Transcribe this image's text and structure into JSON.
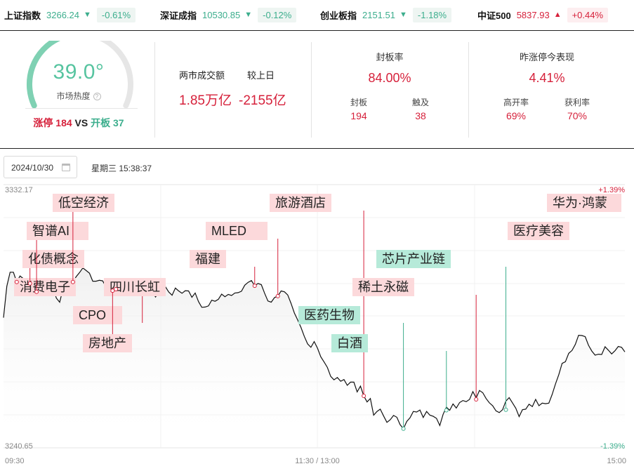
{
  "indices": [
    {
      "name": "上证指数",
      "value": "3266.24",
      "arrow": "▼",
      "change": "-0.61%",
      "dir": "down"
    },
    {
      "name": "深证成指",
      "value": "10530.85",
      "arrow": "▼",
      "change": "-0.12%",
      "dir": "down"
    },
    {
      "name": "创业板指",
      "value": "2151.51",
      "arrow": "▼",
      "change": "-1.18%",
      "dir": "down"
    },
    {
      "name": "中证500",
      "value": "5837.93",
      "arrow": "▲",
      "change": "+0.44%",
      "dir": "up"
    }
  ],
  "heat": {
    "value": "39.0°",
    "label": "市场热度",
    "help_icon": "question-icon",
    "level": 0.39,
    "zt_label": "涨停",
    "zt_count": "184",
    "vs": "VS",
    "kb_label": "开板",
    "kb_count": "37"
  },
  "turnover": {
    "label1": "两市成交额",
    "label2": "较上日",
    "value1": "1.85万亿",
    "value2": "-2155亿"
  },
  "seal": {
    "title": "封板率",
    "rate": "84.00%",
    "sub1_label": "封板",
    "sub1_value": "194",
    "sub2_label": "触及",
    "sub2_value": "38"
  },
  "yesterday": {
    "title": "昨涨停今表现",
    "rate": "4.41%",
    "sub1_label": "高开率",
    "sub1_value": "69%",
    "sub2_label": "获利率",
    "sub2_value": "70%"
  },
  "date": {
    "value": "2024/10/30",
    "icon": "calendar-icon",
    "weekday_time": "星期三 15:38:37"
  },
  "colors": {
    "red": "#d6213b",
    "green": "#3cae8d",
    "tag_red": "#fcd9db",
    "tag_green": "#b6ead9",
    "line": "#111111"
  },
  "chart_data": {
    "type": "line",
    "y_top_label": "3332.17",
    "y_bottom_label": "3240.65",
    "right_top_label": "+1.39%",
    "right_bottom_label": "-1.39%",
    "x_tick_labels": [
      "09:30",
      "11:30 / 13:00",
      "15:00"
    ],
    "ylim": [
      3240.65,
      3332.17
    ],
    "series": [
      {
        "values": [
          3285.9,
          3296.8,
          3301.7,
          3301.7,
          3298.3,
          3300.4,
          3299.5,
          3298.9,
          3297.8,
          3296.4,
          3294.9,
          3293.8,
          3294.8,
          3296.4,
          3294.6,
          3296.1,
          3292.7,
          3291.3,
          3295.9,
          3296.9,
          3296.1,
          3298.3,
          3300.2,
          3301.6,
          3303.2,
          3302.3,
          3301.4,
          3298.6,
          3298.6,
          3298.9,
          3298.7,
          3296.6,
          3296.1,
          3295.3,
          3295.8,
          3297.7,
          3298.3,
          3299.1,
          3297.0,
          3297.4,
          3296.3,
          3296.6,
          3295.3,
          3294.5,
          3294.6,
          3294.9,
          3293.1,
          3294.7,
          3295.1,
          3296.6,
          3294.8,
          3293.7,
          3296.2,
          3295.2,
          3294.4,
          3295.3,
          3295.2,
          3293.0,
          3294.5,
          3291.5,
          3289.5,
          3289.6,
          3290.0,
          3292.0,
          3291.6,
          3292.3,
          3294.1,
          3293.2,
          3294.0,
          3293.6,
          3294.5,
          3294.6,
          3295.1,
          3297.2,
          3298.2,
          3298.8,
          3297.0,
          3297.8,
          3297.4,
          3294.4,
          3291.7,
          3291.3,
          3292.9,
          3293.4,
          3295.2,
          3294.9,
          3293.8,
          3290.9,
          3287.5,
          3285.1,
          3282.5,
          3279.4,
          3276.8,
          3275.6,
          3277.6,
          3275.3,
          3272.3,
          3270.5,
          3268.6,
          3265.5,
          3264.3,
          3265.1,
          3263.8,
          3264.4,
          3262.4,
          3263.5,
          3263.5,
          3260.1,
          3262.1,
          3258.7,
          3256.6,
          3257.8,
          3252.0,
          3253.3,
          3254.1,
          3251.7,
          3249.5,
          3250.4,
          3251.9,
          3251.3,
          3248.7,
          3247.3,
          3249.8,
          3251.1,
          3253.3,
          3253.1,
          3253.8,
          3251.2,
          3253.3,
          3252.0,
          3251.6,
          3250.9,
          3248.4,
          3252.3,
          3254.8,
          3253.7,
          3255.9,
          3254.5,
          3256.4,
          3257.1,
          3256.7,
          3257.5,
          3260.2,
          3258.0,
          3260.6,
          3259.8,
          3257.8,
          3256.3,
          3255.3,
          3253.5,
          3252.9,
          3253.9,
          3256.9,
          3258.1,
          3256.3,
          3254.4,
          3251.5,
          3253.9,
          3254.1,
          3255.8,
          3255.0,
          3257.5,
          3255.3,
          3256.2,
          3256.0,
          3256.2,
          3259.2,
          3262.8,
          3266.1,
          3270.0,
          3270.6,
          3273.5,
          3274.5,
          3276.6,
          3279.8,
          3279.7,
          3279.3,
          3276.3,
          3274.3,
          3272.9,
          3273.2,
          3273.1,
          3275.8,
          3274.6,
          3273.3,
          3274.4,
          3275.9,
          3275.6,
          3274.0
        ]
      }
    ],
    "markers": [
      {
        "idx": 4,
        "series_value": 3298.3,
        "label": "消费电子",
        "color": "red"
      },
      {
        "idx": 8,
        "series_value": 3297.8,
        "label": "化债概念",
        "color": "red"
      },
      {
        "idx": 10,
        "series_value": 3294.9,
        "label": "智谱AI",
        "color": "red"
      },
      {
        "idx": 21,
        "series_value": 3298.3,
        "label": "低空经济",
        "color": "red"
      },
      {
        "idx": 42,
        "series_value": 3295.3,
        "label": "CPO",
        "color": "red"
      },
      {
        "idx": 34,
        "series_value": 3295.8,
        "label": "四川长虹",
        "color": "red"
      },
      {
        "idx": 33,
        "series_value": 3295.3,
        "label": "房地产",
        "color": "red"
      },
      {
        "idx": 76,
        "series_value": 3297.0,
        "label": "福建",
        "color": "red"
      },
      {
        "idx": 83,
        "series_value": 3293.4,
        "label": "MLED",
        "color": "red"
      },
      {
        "idx": 109,
        "series_value": 3258.7,
        "label": "旅游酒店",
        "color": "red"
      },
      {
        "idx": 121,
        "series_value": 3247.3,
        "label": "医药生物",
        "color": "green"
      },
      {
        "idx": 134,
        "series_value": 3253.7,
        "label": "白酒",
        "color": "green"
      },
      {
        "idx": 143,
        "series_value": 3257.5,
        "label": "稀土永磁",
        "color": "red"
      },
      {
        "idx": 152,
        "series_value": 3253.9,
        "label": "芯片产业链",
        "color": "green"
      },
      {
        "idx": 205,
        "series_value": 3256.2,
        "label": "医疗美容",
        "color": "red"
      },
      {
        "idx": 220,
        "series_value": 3270.6,
        "label": "华为·鸿蒙",
        "color": "red"
      }
    ]
  }
}
